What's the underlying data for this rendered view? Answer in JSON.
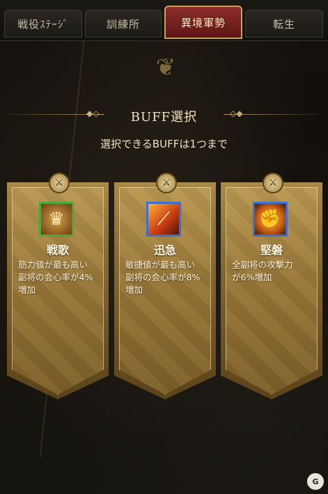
{
  "tabs": [
    {
      "label": "戦役ｽﾃｰｼﾞ"
    },
    {
      "label": "訓練所"
    },
    {
      "label": "異境軍勢"
    },
    {
      "label": "転生"
    }
  ],
  "active_tab": "異境軍勢",
  "header": {
    "title": "BUFF選択",
    "subtitle": "選択できるBUFFは1つまで"
  },
  "cards": [
    {
      "name": "戦歌",
      "description": "筋力値が最も高い\n副将の会心率が4%\n増加",
      "icon": "war-song-icon",
      "border_color": "#49a83b"
    },
    {
      "name": "迅急",
      "description": "敏捷値が最も高い\n副将の会心率が8%\n増加",
      "icon": "swift-slash-icon",
      "border_color": "#3c6fd0"
    },
    {
      "name": "堅磐",
      "description": "全副将の攻撃力\nが6%増加",
      "icon": "fist-strike-icon",
      "border_color": "#3c6fd0"
    }
  ],
  "colors": {
    "active_tab": "#8a2d2a",
    "card_gold": "#a98a4b",
    "background": "#14110d"
  }
}
